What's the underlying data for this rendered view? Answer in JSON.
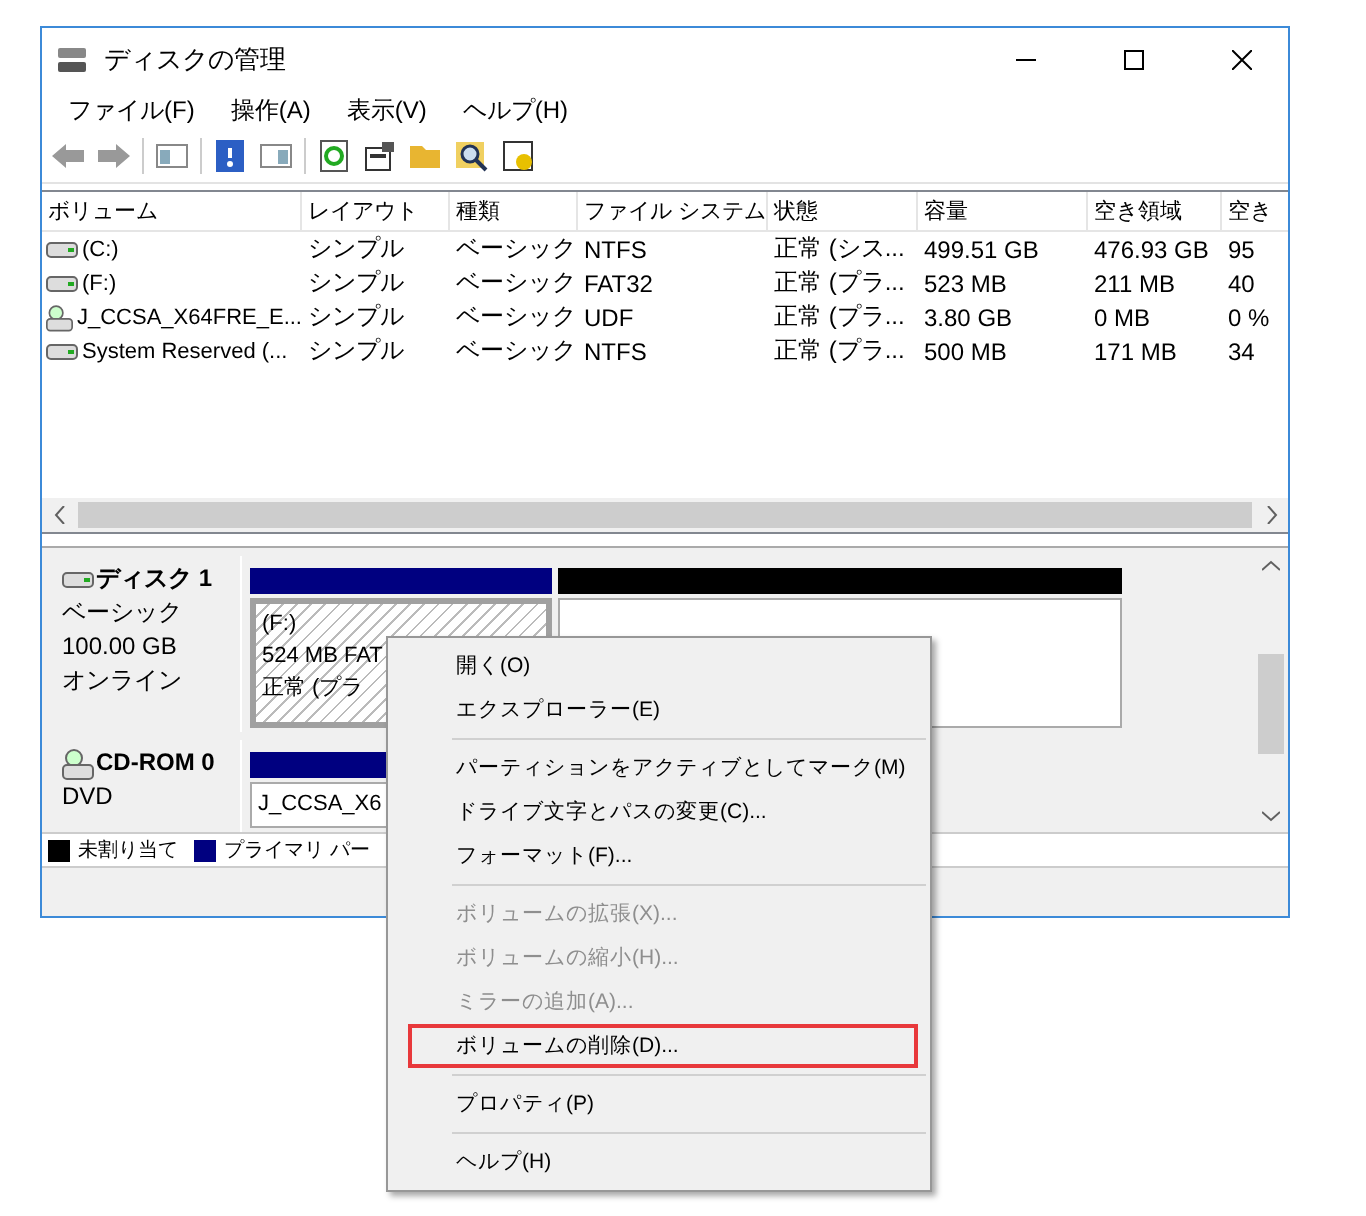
{
  "window": {
    "title": "ディスクの管理"
  },
  "menu": [
    "ファイル(F)",
    "操作(A)",
    "表示(V)",
    "ヘルプ(H)"
  ],
  "volumes": {
    "columns": [
      "ボリューム",
      "レイアウト",
      "種類",
      "ファイル システム",
      "状態",
      "容量",
      "空き領域",
      "空き"
    ],
    "rows": [
      {
        "kind": "disk",
        "cells": [
          "(C:)",
          "シンプル",
          "ベーシック",
          "NTFS",
          "正常 (シス...",
          "499.51 GB",
          "476.93 GB",
          "95"
        ]
      },
      {
        "kind": "disk",
        "cells": [
          "(F:)",
          "シンプル",
          "ベーシック",
          "FAT32",
          "正常 (プラ...",
          "523 MB",
          "211 MB",
          "40"
        ]
      },
      {
        "kind": "cd",
        "cells": [
          "J_CCSA_X64FRE_E...",
          "シンプル",
          "ベーシック",
          "UDF",
          "正常 (プラ...",
          "3.80 GB",
          "0 MB",
          "0 %"
        ]
      },
      {
        "kind": "disk",
        "cells": [
          "System Reserved (...",
          "シンプル",
          "ベーシック",
          "NTFS",
          "正常 (プラ...",
          "500 MB",
          "171 MB",
          "34"
        ]
      }
    ]
  },
  "disks": [
    {
      "kind": "disk",
      "name": "ディスク 1",
      "lines": [
        "ベーシック",
        "100.00 GB",
        "オンライン"
      ],
      "partitions": [
        {
          "kind": "primary",
          "selected": true,
          "lines": [
            "(F:)",
            "524 MB FAT",
            "正常 (プラ"
          ]
        },
        {
          "kind": "unallocated",
          "selected": false
        }
      ]
    },
    {
      "kind": "cd",
      "name": "CD-ROM 0",
      "lines": [
        "DVD"
      ],
      "partitions": [
        {
          "kind": "primary",
          "selected": false,
          "lines": [
            "J_CCSA_X6"
          ]
        }
      ]
    }
  ],
  "legend": [
    {
      "label": "未割り当て",
      "color": "#000000"
    },
    {
      "label": "プライマリ パー",
      "color": "#000080"
    }
  ],
  "context_menu": [
    {
      "kind": "item",
      "label": "開く(O)",
      "disabled": false,
      "highlighted": false
    },
    {
      "kind": "item",
      "label": "エクスプローラー(E)",
      "disabled": false,
      "highlighted": false
    },
    {
      "kind": "separator"
    },
    {
      "kind": "item",
      "label": "パーティションをアクティブとしてマーク(M)",
      "disabled": false,
      "highlighted": false
    },
    {
      "kind": "item",
      "label": "ドライブ文字とパスの変更(C)...",
      "disabled": false,
      "highlighted": false
    },
    {
      "kind": "item",
      "label": "フォーマット(F)...",
      "disabled": false,
      "highlighted": false
    },
    {
      "kind": "separator"
    },
    {
      "kind": "item",
      "label": "ボリュームの拡張(X)...",
      "disabled": true,
      "highlighted": false
    },
    {
      "kind": "item",
      "label": "ボリュームの縮小(H)...",
      "disabled": true,
      "highlighted": false
    },
    {
      "kind": "item",
      "label": "ミラーの追加(A)...",
      "disabled": true,
      "highlighted": false
    },
    {
      "kind": "item",
      "label": "ボリュームの削除(D)...",
      "disabled": false,
      "highlighted": true
    },
    {
      "kind": "separator"
    },
    {
      "kind": "item",
      "label": "プロパティ(P)",
      "disabled": false,
      "highlighted": false
    },
    {
      "kind": "separator"
    },
    {
      "kind": "item",
      "label": "ヘルプ(H)",
      "disabled": false,
      "highlighted": false
    }
  ]
}
